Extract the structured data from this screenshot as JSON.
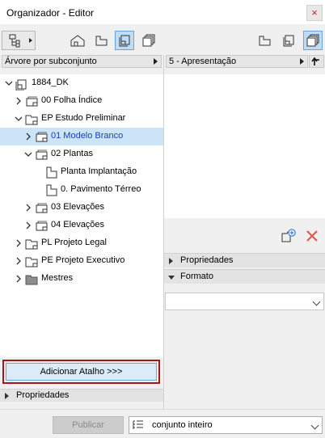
{
  "window": {
    "title": "Organizador - Editor",
    "close_glyph": "×"
  },
  "left": {
    "view_selector": "Árvore por subconjunto",
    "tree": [
      {
        "label": "1884_DK",
        "icon": "project-map-icon",
        "expander": "down",
        "depth": 0
      },
      {
        "label": "00 Folha Índice",
        "icon": "layout-sheet-icon",
        "expander": "right",
        "depth": 1
      },
      {
        "label": "EP Estudo Preliminar",
        "icon": "folder-icon",
        "expander": "down",
        "depth": 1
      },
      {
        "label": "01 Modelo Branco",
        "icon": "layout-sheet-icon",
        "expander": "right",
        "depth": 2,
        "selected": true
      },
      {
        "label": "02 Plantas",
        "icon": "layout-sheet-icon",
        "expander": "down",
        "depth": 2
      },
      {
        "label": "Planta Implantação",
        "icon": "view-page-icon",
        "expander": "none",
        "depth": 3
      },
      {
        "label": "0. Pavimento Térreo",
        "icon": "view-page-icon",
        "expander": "none",
        "depth": 3
      },
      {
        "label": "03 Elevações",
        "icon": "layout-sheet-icon",
        "expander": "right",
        "depth": 2
      },
      {
        "label": "04 Elevações",
        "icon": "layout-sheet-icon",
        "expander": "right",
        "depth": 2
      },
      {
        "label": "PL Projeto Legal",
        "icon": "folder-icon",
        "expander": "right",
        "depth": 1
      },
      {
        "label": "PE Projeto Executivo",
        "icon": "folder-icon",
        "expander": "right",
        "depth": 1
      },
      {
        "label": "Mestres",
        "icon": "masters-folder-icon",
        "expander": "right",
        "depth": 1
      }
    ],
    "add_shortcut_label": "Adicionar Atalho >>>",
    "properties_label": "Propriedades"
  },
  "right": {
    "set_selector": "5 - Apresentação",
    "properties_label": "Propriedades",
    "format_label": "Formato",
    "format_value": ""
  },
  "footer": {
    "publish_label": "Publicar",
    "scope_value": "conjunto inteiro"
  },
  "colors": {
    "accent": "#cce4f7",
    "selected_text": "#1a3fb0",
    "active_button": "#bfdcf6",
    "highlight_border": "#a0161d",
    "delete_icon": "#e05a4a",
    "add_icon": "#3b7fd1"
  }
}
